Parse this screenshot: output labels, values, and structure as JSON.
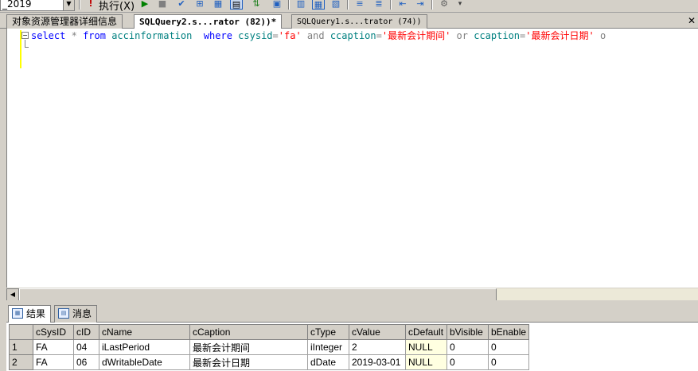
{
  "toolbar": {
    "database": "_2019",
    "execute_label": "执行(X)"
  },
  "tabs": [
    {
      "label": "对象资源管理器详细信息"
    },
    {
      "label": "SQLQuery2.s...rator (82))*"
    },
    {
      "label": "SQLQuery1.s...trator (74))"
    }
  ],
  "tab_close": "✕",
  "editor": {
    "line1": {
      "select": "select",
      "star": "*",
      "from": "from",
      "table": "accinformation",
      "where": "where",
      "col1": "csysid",
      "eq1": "=",
      "val1": "'fa'",
      "and": "and",
      "col2": "ccaption",
      "eq2": "=",
      "val2": "'最新会计期间'",
      "or1": "or",
      "col3": "ccaption",
      "eq3": "=",
      "val3": "'最新会计日期'",
      "trail": "o"
    }
  },
  "results_tabs": [
    {
      "label": "结果"
    },
    {
      "label": "消息"
    }
  ],
  "grid": {
    "columns": [
      "cSysID",
      "cID",
      "cName",
      "cCaption",
      "cType",
      "cValue",
      "cDefault",
      "bVisible",
      "bEnable"
    ],
    "rows": [
      {
        "num": "1",
        "cells": [
          "FA",
          "04",
          "iLastPeriod",
          "最新会计期间",
          "iInteger",
          "2",
          "NULL",
          "0",
          "0"
        ]
      },
      {
        "num": "2",
        "cells": [
          "FA",
          "06",
          "dWritableDate",
          "最新会计日期",
          "dDate",
          "2019-03-01",
          "NULL",
          "0",
          "0"
        ]
      }
    ]
  }
}
